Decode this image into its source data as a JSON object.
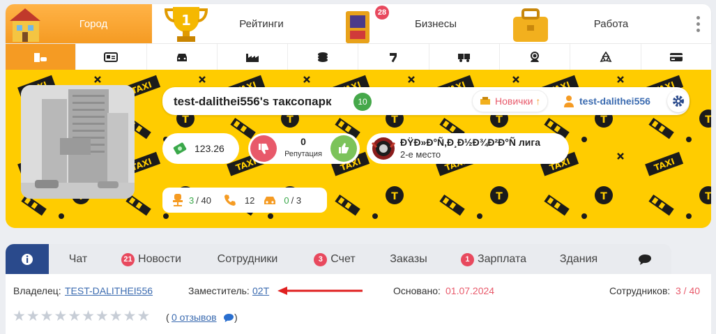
{
  "top_nav": [
    {
      "label": "Город",
      "active": true
    },
    {
      "label": "Рейтинги",
      "active": false
    },
    {
      "label": "Бизнесы",
      "active": false,
      "badge": "28"
    },
    {
      "label": "Работа",
      "active": false
    }
  ],
  "sub_nav_icons": [
    "taxi-building-icon",
    "id-card-icon",
    "car-front-icon",
    "factory-icon",
    "coins-icon",
    "hammer-icon",
    "truck-icon",
    "headset-icon",
    "recycle-icon",
    "credit-card-icon"
  ],
  "company": {
    "name": "test-dalithei556's таксопарк",
    "level": "10",
    "league_btn": "Новички",
    "owner_user": "test-dalithei556",
    "money": "123.26",
    "reputation_value": "0",
    "reputation_label": "Репутация",
    "league_name": "ÐŸÐ»Ð°Ñ‚Ð¸Ð½Ð¾Ð²Ð°Ñ лига",
    "league_place": "2-е место",
    "employees_cur": "3",
    "employees_sep": "/ 40",
    "calls": "12",
    "cars_cur": "0",
    "cars_sep": "/ 3"
  },
  "tabs": [
    {
      "label": ""
    },
    {
      "label": "Чат"
    },
    {
      "label": "Новости",
      "badge": "21"
    },
    {
      "label": "Сотрудники"
    },
    {
      "label": "Счет",
      "badge": "3"
    },
    {
      "label": "Заказы"
    },
    {
      "label": "Зарплата",
      "badge": "1"
    },
    {
      "label": "Здания"
    },
    {
      "label": ""
    }
  ],
  "info": {
    "owner_label": "Владелец:",
    "owner_value": "TEST-DALITHEI556",
    "deputy_label": "Заместитель:",
    "deputy_value": "02T",
    "founded_label": "Основано:",
    "founded_value": "01.07.2024",
    "staff_label": "Сотрудников:",
    "staff_value": "3 / 40",
    "reviews_open": "(",
    "reviews_link": "0 отзывов",
    "reviews_close": ")"
  },
  "rating_stars": 10,
  "colors": {
    "accent": "#f59b23",
    "tab_active": "#2a4a8c",
    "badge": "#e8495e",
    "banner": "#ffcc00",
    "link": "#3b6bb0"
  }
}
